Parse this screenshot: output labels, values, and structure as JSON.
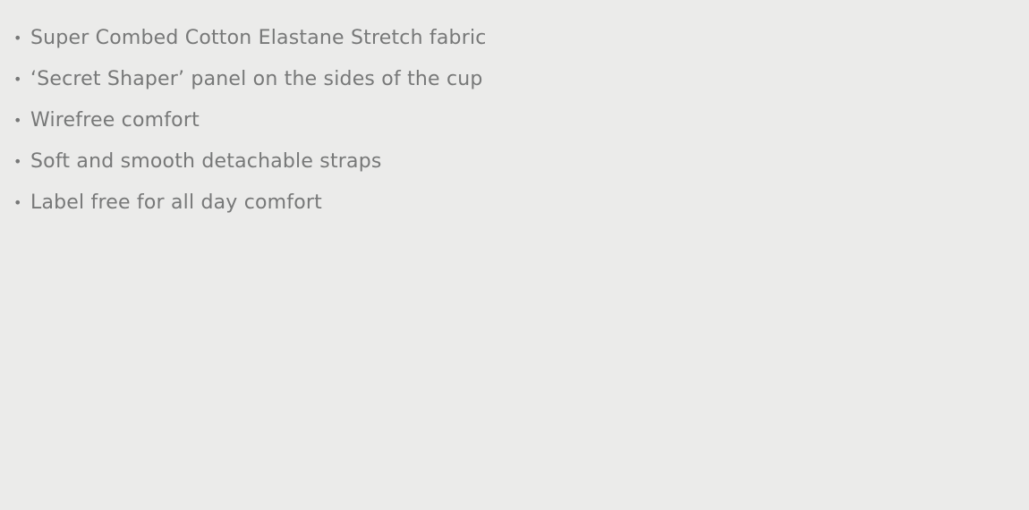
{
  "features": [
    {
      "text": "Super Combed Cotton Elastane Stretch fabric"
    },
    {
      "text": "‘Secret Shaper’ panel on the sides of the cup"
    },
    {
      "text": "Wirefree comfort"
    },
    {
      "text": "Soft and smooth detachable straps"
    },
    {
      "text": "Label free for all day comfort"
    }
  ],
  "bullet_glyph": "•",
  "colors": {
    "background": "#ebebea",
    "text": "#777878"
  }
}
